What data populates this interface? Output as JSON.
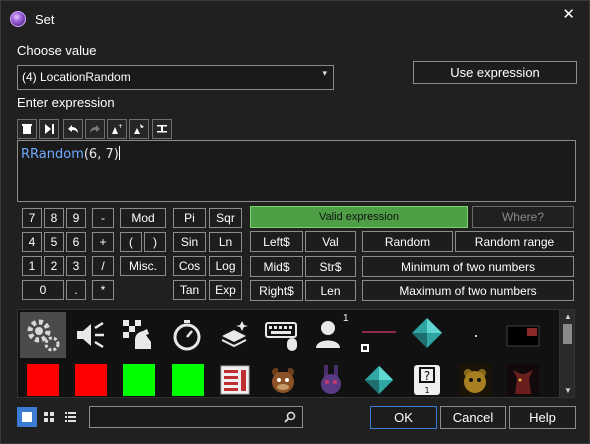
{
  "window": {
    "title": "Set",
    "close_glyph": "✕"
  },
  "choose": {
    "label": "Choose value",
    "selected": "(4) LocationRandom",
    "chevron": "▾"
  },
  "use_expression_label": "Use expression",
  "enter_expression_label": "Enter expression",
  "toolbar": [
    "trash-icon",
    "skip-to-end-icon",
    "undo-icon",
    "redo-icon",
    "add-parameter-icon",
    "insert-parameter-icon",
    "wrap-lines-icon"
  ],
  "expression": {
    "function": "RRandom",
    "args": "(6, 7)"
  },
  "keypad": {
    "digits": [
      "7",
      "8",
      "9",
      "4",
      "5",
      "6",
      "1",
      "2",
      "3",
      "0"
    ],
    "ops": [
      "-",
      "+",
      "/",
      "*"
    ],
    "dot": ".",
    "paren_open": "(",
    "paren_close": ")",
    "mod": "Mod",
    "misc": "Misc.",
    "pi": "Pi",
    "sqr": "Sqr",
    "sin": "Sin",
    "ln": "Ln",
    "cos": "Cos",
    "log": "Log",
    "tan": "Tan",
    "exp": "Exp",
    "left": "Left$",
    "val": "Val",
    "mid": "Mid$",
    "str": "Str$",
    "right": "Right$",
    "len": "Len"
  },
  "status": {
    "valid": "Valid expression",
    "valid_color": "#4d9e45",
    "where": "Where?"
  },
  "funcs": {
    "random": "Random",
    "random_range": "Random range",
    "min": "Minimum of two numbers",
    "max": "Maximum of two numbers"
  },
  "objects": {
    "row1": [
      "system-gear-icon",
      "speaker-icon",
      "chess-knight-icon",
      "timer-icon",
      "layers-icon",
      "keyboard-mouse-icon",
      "player-icon",
      "line-object-icon",
      "diamond-active-icon",
      "small-dot-object-icon",
      "black-box-object-icon"
    ],
    "row2": [
      "red-box-1",
      "red-box-2",
      "green-box-1",
      "green-box-2",
      "list-object-icon",
      "freddy-icon",
      "bonnie-icon",
      "diamond-icon",
      "question-box-icon",
      "golden-freddy-icon",
      "foxy-icon"
    ],
    "player_number": "1",
    "question_number": "1",
    "question_glyph": "?"
  },
  "bottom": {
    "ok": "OK",
    "cancel": "Cancel",
    "help": "Help",
    "search_placeholder": "",
    "view_modes": [
      "large-icons-icon",
      "small-icons-icon",
      "list-view-icon"
    ]
  }
}
